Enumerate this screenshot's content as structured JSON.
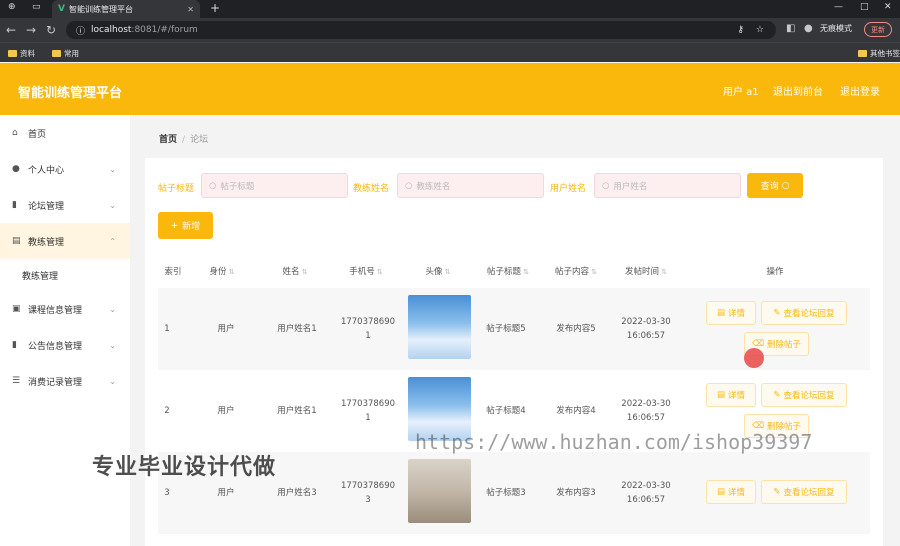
{
  "browser": {
    "tab_title": "智能训练管理平台",
    "url_host": "localhost",
    "url_path": ":8081/#/forum",
    "incognito_label": "无痕模式",
    "update_label": "更新",
    "bookmarks": [
      "资料",
      "常用"
    ],
    "other_bookmarks": "其他书签"
  },
  "header": {
    "title": "智能训练管理平台",
    "user": "用户 a1",
    "back_to_admin": "退出到前台",
    "logout": "退出登录"
  },
  "sidebar": {
    "items": [
      {
        "label": "首页",
        "icon": "home-icon"
      },
      {
        "label": "个人中心",
        "icon": "user-icon"
      },
      {
        "label": "论坛管理",
        "icon": "bar-chart-icon"
      },
      {
        "label": "教练管理",
        "icon": "folder-icon"
      },
      {
        "label": "课程信息管理",
        "icon": "doc-icon"
      },
      {
        "label": "公告信息管理",
        "icon": "bar-chart-icon"
      },
      {
        "label": "消费记录管理",
        "icon": "list-icon"
      }
    ],
    "sub_item": "教练管理"
  },
  "breadcrumb": {
    "home": "首页",
    "current": "论坛"
  },
  "filters": [
    {
      "label": "帖子标题",
      "placeholder": "帖子标题"
    },
    {
      "label": "教练姓名",
      "placeholder": "教练姓名"
    },
    {
      "label": "用户姓名",
      "placeholder": "用户姓名"
    }
  ],
  "query_label": "查询",
  "add_label": "新增",
  "columns": [
    "索引",
    "身份",
    "姓名",
    "手机号",
    "头像",
    "帖子标题",
    "帖子内容",
    "发帖时间",
    "操作"
  ],
  "rows": [
    {
      "index": "1",
      "role": "用户",
      "name": "用户姓名1",
      "phone1": "1770378690",
      "phone2": "1",
      "title": "帖子标题5",
      "content": "发布内容5",
      "date": "2022-03-30",
      "time": "16:06:57",
      "avatar": "sky"
    },
    {
      "index": "2",
      "role": "用户",
      "name": "用户姓名1",
      "phone1": "1770378690",
      "phone2": "1",
      "title": "帖子标题4",
      "content": "发布内容4",
      "date": "2022-03-30",
      "time": "16:06:57",
      "avatar": "sky"
    },
    {
      "index": "3",
      "role": "用户",
      "name": "用户姓名3",
      "phone1": "1770378690",
      "phone2": "3",
      "title": "帖子标题3",
      "content": "发布内容3",
      "date": "2022-03-30",
      "time": "16:06:57",
      "avatar": "person"
    }
  ],
  "actions": {
    "detail": "详情",
    "view_replies": "查看论坛回复",
    "delete": "删除帖子"
  },
  "watermarks": {
    "left": "专业毕业设计代做",
    "right": "https://www.huzhan.com/ishop39397"
  },
  "colors": {
    "accent": "#fbb80c",
    "input_bg": "#fdeef0"
  }
}
